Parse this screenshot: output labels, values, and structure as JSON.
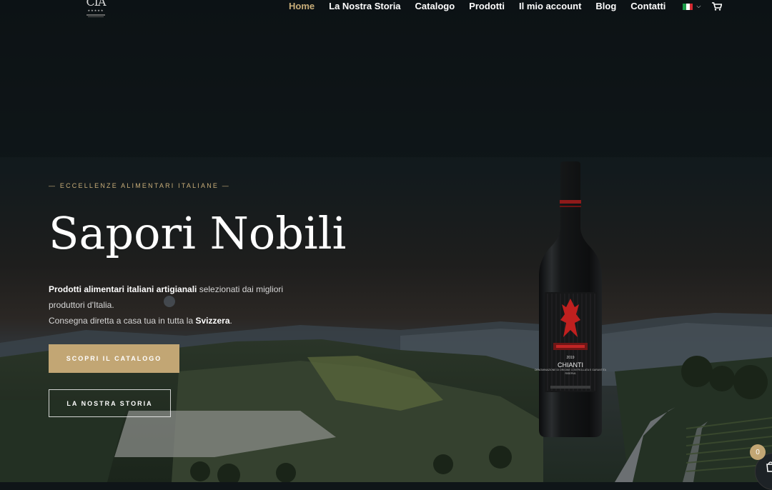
{
  "header": {
    "logo_text": "CIA",
    "nav": [
      {
        "label": "Home",
        "active": true
      },
      {
        "label": "La Nostra Storia",
        "active": false
      },
      {
        "label": "Catalogo",
        "active": false
      },
      {
        "label": "Prodotti",
        "active": false
      },
      {
        "label": "Il mio account",
        "active": false
      },
      {
        "label": "Blog",
        "active": false
      },
      {
        "label": "Contatti",
        "active": false
      }
    ],
    "language_flag": "italy-flag-icon",
    "cart_icon": "cart-icon"
  },
  "hero": {
    "eyebrow": "— ECCELLENZE ALIMENTARI ITALIANE —",
    "title": "Sapori Nobili",
    "desc_bold": "Prodotti alimentari italiani artigianali",
    "desc_rest": " selezionati dai migliori produttori d'Italia.",
    "desc_line2_pre": "Consegna diretta a casa tua in tutta la ",
    "desc_line2_bold": "Svizzera",
    "desc_line2_post": ".",
    "primary_button": "SCOPRI IL CATALOGO",
    "secondary_button": "LA NOSTRA STORIA"
  },
  "bottle": {
    "year": "2019",
    "name": "CHIANTI",
    "subtitle": "DENOMINAZIONE DI ORIGINE CONTROLLATA E GARANTITA",
    "riserva": "RISERVA"
  },
  "floating_cart": {
    "count": "0"
  },
  "colors": {
    "accent": "#c2a674",
    "nav_active": "#c8ad79",
    "background": "#0f1518"
  }
}
